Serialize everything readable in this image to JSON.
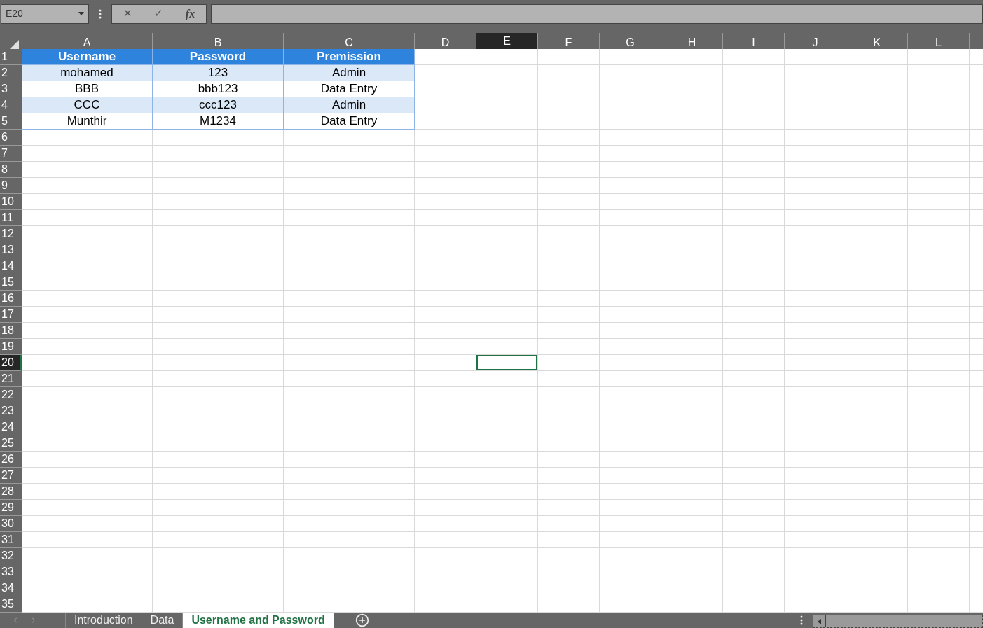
{
  "name_box": {
    "value": "E20"
  },
  "formula_bar": {
    "cancel": "✕",
    "enter": "✓",
    "function": "fx"
  },
  "columns": [
    {
      "label": "A",
      "selected": false
    },
    {
      "label": "B",
      "selected": false
    },
    {
      "label": "C",
      "selected": false
    },
    {
      "label": "D",
      "selected": false
    },
    {
      "label": "E",
      "selected": true
    },
    {
      "label": "F",
      "selected": false
    },
    {
      "label": "G",
      "selected": false
    },
    {
      "label": "H",
      "selected": false
    },
    {
      "label": "I",
      "selected": false
    },
    {
      "label": "J",
      "selected": false
    },
    {
      "label": "K",
      "selected": false
    },
    {
      "label": "L",
      "selected": false
    }
  ],
  "rows": [
    {
      "label": "1",
      "selected": false
    },
    {
      "label": "2",
      "selected": false
    },
    {
      "label": "3",
      "selected": false
    },
    {
      "label": "4",
      "selected": false
    },
    {
      "label": "5",
      "selected": false
    },
    {
      "label": "6",
      "selected": false
    },
    {
      "label": "7",
      "selected": false
    },
    {
      "label": "8",
      "selected": false
    },
    {
      "label": "9",
      "selected": false
    },
    {
      "label": "10",
      "selected": false
    },
    {
      "label": "11",
      "selected": false
    },
    {
      "label": "12",
      "selected": false
    },
    {
      "label": "13",
      "selected": false
    },
    {
      "label": "14",
      "selected": false
    },
    {
      "label": "15",
      "selected": false
    },
    {
      "label": "16",
      "selected": false
    },
    {
      "label": "17",
      "selected": false
    },
    {
      "label": "18",
      "selected": false
    },
    {
      "label": "19",
      "selected": false
    },
    {
      "label": "20",
      "selected": true
    },
    {
      "label": "21",
      "selected": false
    },
    {
      "label": "22",
      "selected": false
    },
    {
      "label": "23",
      "selected": false
    },
    {
      "label": "24",
      "selected": false
    },
    {
      "label": "25",
      "selected": false
    },
    {
      "label": "26",
      "selected": false
    },
    {
      "label": "27",
      "selected": false
    },
    {
      "label": "28",
      "selected": false
    },
    {
      "label": "29",
      "selected": false
    },
    {
      "label": "30",
      "selected": false
    },
    {
      "label": "31",
      "selected": false
    },
    {
      "label": "32",
      "selected": false
    },
    {
      "label": "33",
      "selected": false
    },
    {
      "label": "34",
      "selected": false
    },
    {
      "label": "35",
      "selected": false
    }
  ],
  "table": {
    "columns": [
      "Username",
      "Password",
      "Premission"
    ],
    "rows": [
      [
        "mohamed",
        "123",
        "Admin"
      ],
      [
        "BBB",
        "bbb123",
        "Data Entry"
      ],
      [
        "CCC",
        "ccc123",
        "Admin"
      ],
      [
        "Munthir",
        "M1234",
        "Data Entry"
      ]
    ]
  },
  "sheet_tabs": [
    {
      "label": "Introduction",
      "selected": false
    },
    {
      "label": "Data",
      "selected": false
    },
    {
      "label": "Username and Password",
      "selected": true
    }
  ]
}
